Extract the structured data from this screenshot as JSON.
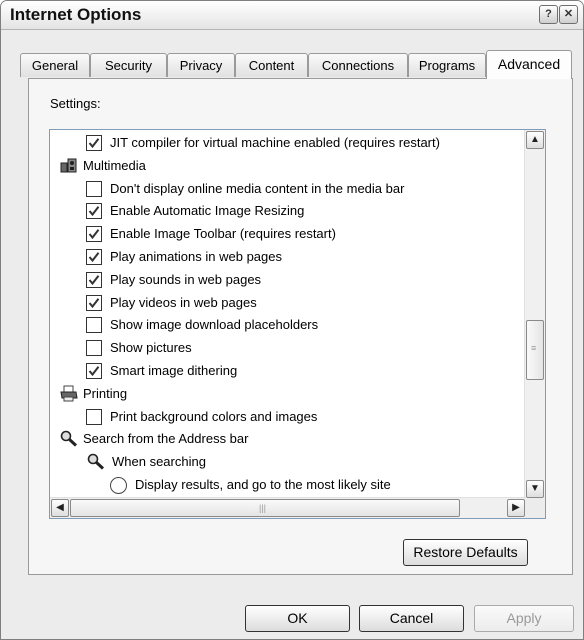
{
  "window": {
    "title": "Internet Options",
    "help_btn": "?",
    "close_btn": "✕"
  },
  "tabs": [
    {
      "label": "General"
    },
    {
      "label": "Security"
    },
    {
      "label": "Privacy"
    },
    {
      "label": "Content"
    },
    {
      "label": "Connections"
    },
    {
      "label": "Programs"
    },
    {
      "label": "Advanced",
      "selected": true
    }
  ],
  "settings": {
    "label": "Settings:",
    "items": [
      {
        "type": "checkbox",
        "checked": true,
        "label": "JIT compiler for virtual machine enabled (requires restart)"
      },
      {
        "type": "category",
        "icon": "multimedia-icon",
        "label": "Multimedia"
      },
      {
        "type": "checkbox",
        "checked": false,
        "label": "Don't display online media content in the media bar"
      },
      {
        "type": "checkbox",
        "checked": true,
        "label": "Enable Automatic Image Resizing"
      },
      {
        "type": "checkbox",
        "checked": true,
        "label": "Enable Image Toolbar (requires restart)"
      },
      {
        "type": "checkbox",
        "checked": true,
        "label": "Play animations in web pages"
      },
      {
        "type": "checkbox",
        "checked": true,
        "label": "Play sounds in web pages"
      },
      {
        "type": "checkbox",
        "checked": true,
        "label": "Play videos in web pages"
      },
      {
        "type": "checkbox",
        "checked": false,
        "label": "Show image download placeholders"
      },
      {
        "type": "checkbox",
        "checked": false,
        "label": "Show pictures"
      },
      {
        "type": "checkbox",
        "checked": true,
        "label": "Smart image dithering"
      },
      {
        "type": "category",
        "icon": "printer-icon",
        "label": "Printing"
      },
      {
        "type": "checkbox",
        "checked": false,
        "label": "Print background colors and images"
      },
      {
        "type": "category",
        "icon": "magnifier-icon",
        "label": "Search from the Address bar"
      },
      {
        "type": "subcategory",
        "icon": "magnifier-icon",
        "label": "When searching"
      },
      {
        "type": "radio",
        "checked": false,
        "label": "Display results, and go to the most likely site"
      }
    ]
  },
  "buttons": {
    "restore_defaults": "Restore Defaults",
    "ok": "OK",
    "cancel": "Cancel",
    "apply": "Apply"
  },
  "colors": {
    "listbox_border": "#7f9db9",
    "checkmark": "#333333"
  }
}
